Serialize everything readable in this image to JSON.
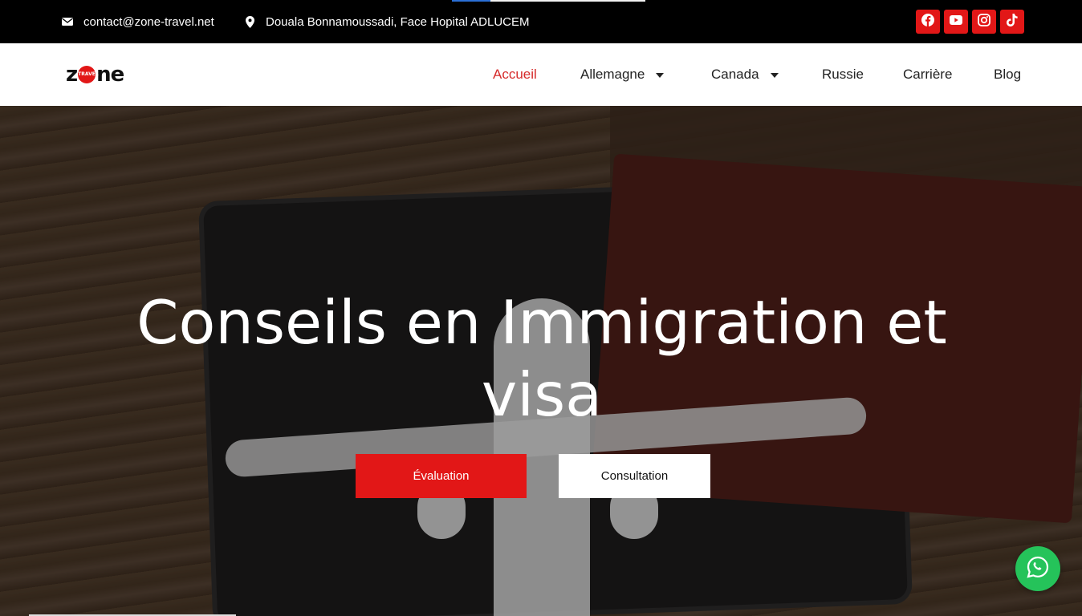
{
  "topbar": {
    "email": "contact@zone-travel.net",
    "address": "Douala Bonnamoussadi, Face Hopital ADLUCEM",
    "email_icon": "envelope-icon",
    "address_icon": "map-marker-icon",
    "socials": [
      {
        "name": "facebook-icon"
      },
      {
        "name": "youtube-icon"
      },
      {
        "name": "instagram-icon"
      },
      {
        "name": "tiktok-icon"
      }
    ],
    "social_color": "#e21717"
  },
  "logo": {
    "text_before": "z",
    "dot_text": "TRAVEL",
    "text_after": "ne"
  },
  "nav": {
    "items": [
      {
        "label": "Accueil",
        "active": true
      },
      {
        "label": "Allemagne",
        "dropdown": true
      },
      {
        "label": "Canada",
        "dropdown": true
      },
      {
        "label": "Russie"
      },
      {
        "label": "Carrière"
      },
      {
        "label": "Blog"
      }
    ],
    "active_color": "#d62b2b"
  },
  "hero": {
    "title": "Conseils en Immigration et visa",
    "primary_button": "Évaluation",
    "secondary_button": "Consultation",
    "accent": "#e21717"
  },
  "whatsapp": {
    "icon": "whatsapp-icon",
    "color": "#25c35a"
  }
}
